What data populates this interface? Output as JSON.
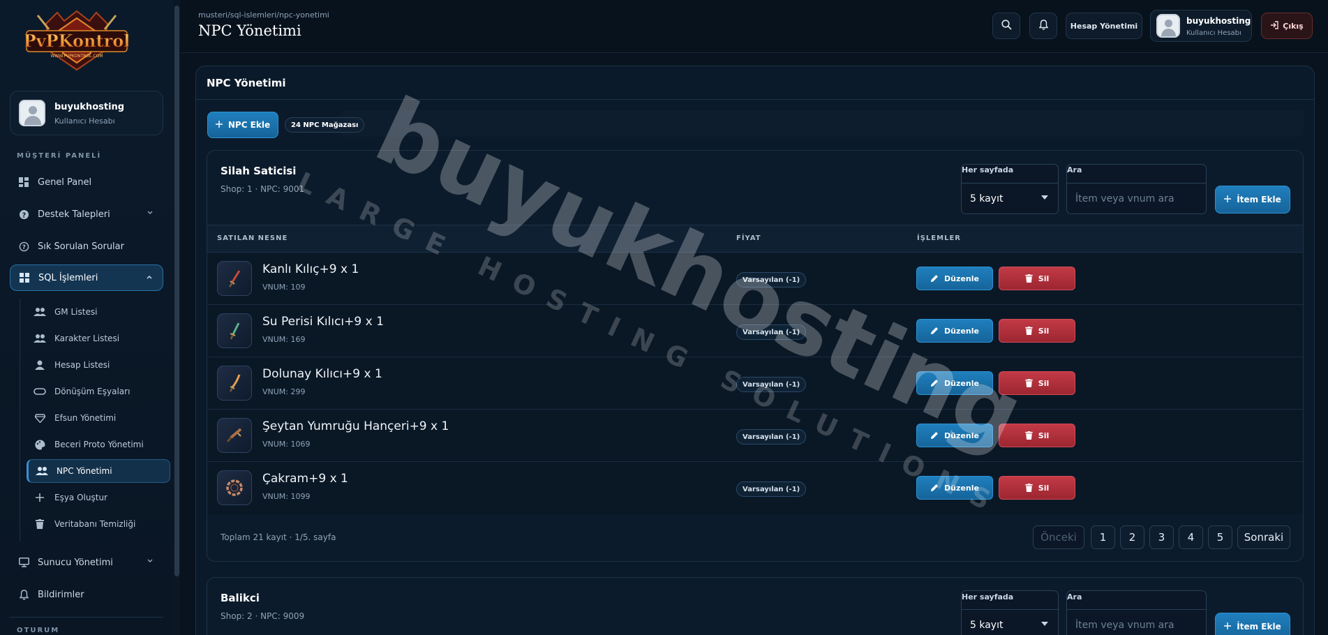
{
  "brand": {
    "logo_text": "PvPKontrol",
    "logo_sub": "WWW.PVPKONTROL.COM"
  },
  "sidebar": {
    "user": {
      "name": "buyukhosting",
      "role": "Kullanıcı Hesabı"
    },
    "section_customer": "MÜŞTERİ PANELİ",
    "section_session": "OTURUM",
    "items": [
      {
        "label": "Genel Panel",
        "icon": "dashboard-icon"
      },
      {
        "label": "Destek Talepleri",
        "icon": "help-icon"
      },
      {
        "label": "Sık Sorulan Sorular",
        "icon": "question-icon"
      },
      {
        "label": "SQL İşlemleri",
        "icon": "database-icon"
      },
      {
        "label": "Sunucu Yönetimi",
        "icon": "monitor-icon"
      },
      {
        "label": "Bildirimler",
        "icon": "bell-icon"
      }
    ],
    "subitems": [
      {
        "label": "GM Listesi",
        "icon": "users-icon"
      },
      {
        "label": "Karakter Listesi",
        "icon": "users-icon"
      },
      {
        "label": "Hesap Listesi",
        "icon": "user-icon"
      },
      {
        "label": "Dönüşüm Eşyaları",
        "icon": "ring-icon"
      },
      {
        "label": "Efsun Yönetimi",
        "icon": "gem-icon"
      },
      {
        "label": "Beceri Proto Yönetimi",
        "icon": "palette-icon"
      },
      {
        "label": "NPC Yönetimi",
        "icon": "users-icon"
      },
      {
        "label": "Eşya Oluştur",
        "icon": "plus-icon"
      },
      {
        "label": "Veritabanı Temizliği",
        "icon": "trash-icon"
      }
    ]
  },
  "header": {
    "breadcrumb": "musteri/sql-islemleri/npc-yonetimi",
    "title": "NPC Yönetimi",
    "account_btn": "Hesap Yönetimi",
    "user": {
      "name": "buyukhosting",
      "role": "Kullanıcı Hesabı"
    },
    "logout": "Çıkış"
  },
  "main": {
    "title": "NPC Yönetimi",
    "add_npc": "NPC Ekle",
    "shop_count": "24 NPC Mağazası"
  },
  "shops": [
    {
      "name": "Silah Saticisi",
      "meta": "Shop: 1 · NPC: 9001",
      "per_page_label": "Her sayfada",
      "per_page_value": "5 kayıt",
      "search_label": "Ara",
      "search_placeholder": "İtem veya vnum ara",
      "add_item": "İtem Ekle",
      "columns": [
        "SATILAN NESNE",
        "FİYAT",
        "İŞLEMLER"
      ],
      "rows": [
        {
          "name": "Kanlı Kılıç+9 x 1",
          "vnum": "VNUM: 109",
          "price": "Varsayılan (-1)"
        },
        {
          "name": "Su Perisi Kılıcı+9 x 1",
          "vnum": "VNUM: 169",
          "price": "Varsayılan (-1)"
        },
        {
          "name": "Dolunay Kılıcı+9 x 1",
          "vnum": "VNUM: 299",
          "price": "Varsayılan (-1)"
        },
        {
          "name": "Şeytan Yumruğu Hançeri+9 x 1",
          "vnum": "VNUM: 1069",
          "price": "Varsayılan (-1)"
        },
        {
          "name": "Çakram+9 x 1",
          "vnum": "VNUM: 1099",
          "price": "Varsayılan (-1)"
        }
      ],
      "edit_label": "Düzenle",
      "delete_label": "Sil",
      "total": "Toplam 21 kayıt · 1/5. sayfa",
      "pagination": {
        "prev": "Önceki",
        "pages": [
          "1",
          "2",
          "3",
          "4",
          "5"
        ],
        "next": "Sonraki"
      }
    },
    {
      "name": "Balikci",
      "meta": "Shop: 2 · NPC: 9009",
      "per_page_label": "Her sayfada",
      "per_page_value": "5 kayıt",
      "search_label": "Ara",
      "search_placeholder": "İtem veya vnum ara",
      "add_item": "İtem Ekle"
    }
  ],
  "watermark": {
    "main": "buyukhosting",
    "sub": "LARGE HOSTING SOLUTIONS"
  },
  "colors": {
    "accent": "#1f7fbd",
    "danger": "#c23a46",
    "bg": "#08131f"
  }
}
